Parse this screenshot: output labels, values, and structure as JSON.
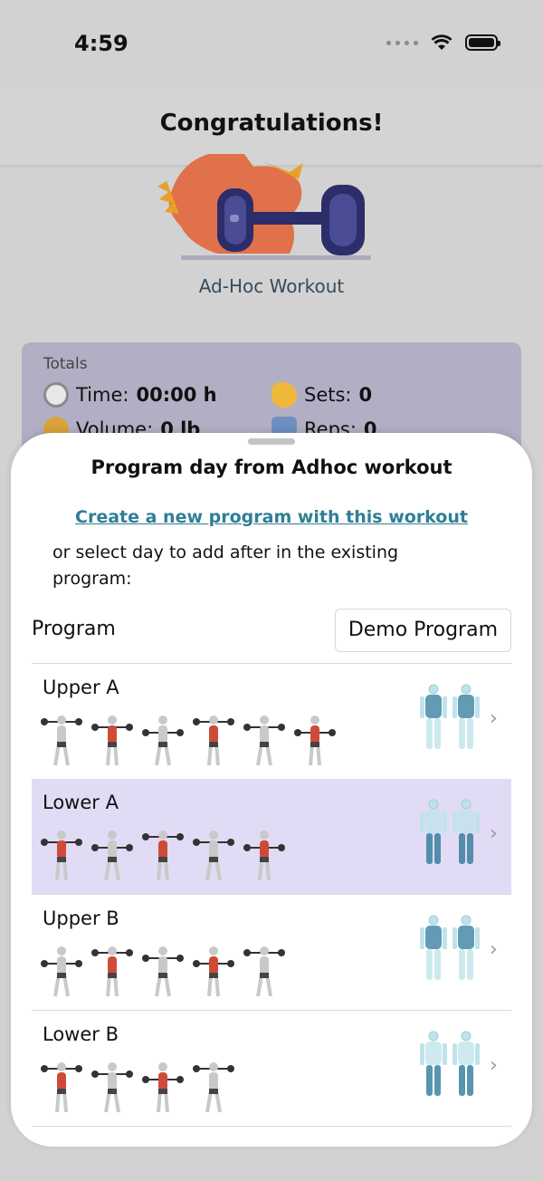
{
  "status_bar": {
    "time": "4:59"
  },
  "header": {
    "title": "Congratulations!"
  },
  "workout": {
    "name": "Ad-Hoc Workout"
  },
  "totals": {
    "label": "Totals",
    "time_label": "Time:",
    "time_value": "00:00 h",
    "sets_label": "Sets:",
    "sets_value": "0",
    "volume_label": "Volume:",
    "volume_value": "0 lb",
    "reps_label": "Reps:",
    "reps_value": "0"
  },
  "sheet": {
    "title": "Program day from Adhoc workout",
    "create_link": "Create a new program with this workout",
    "hint": "or select day to add after in the existing program:",
    "program_label": "Program",
    "program_value": "Demo Program"
  },
  "days": [
    {
      "name": "Upper A",
      "exercise_count": 6,
      "selected": false,
      "focus": "upper"
    },
    {
      "name": "Lower A",
      "exercise_count": 5,
      "selected": true,
      "focus": "lower"
    },
    {
      "name": "Upper B",
      "exercise_count": 5,
      "selected": false,
      "focus": "upper"
    },
    {
      "name": "Lower B",
      "exercise_count": 4,
      "selected": false,
      "focus": "lower"
    }
  ],
  "colors": {
    "accent": "#2f7f95",
    "selected_row": "#e2dbf5",
    "totals_card": "#b2afc4",
    "muscle_base": "#bfe3ea",
    "muscle_highlight": "#2e7a9a"
  }
}
